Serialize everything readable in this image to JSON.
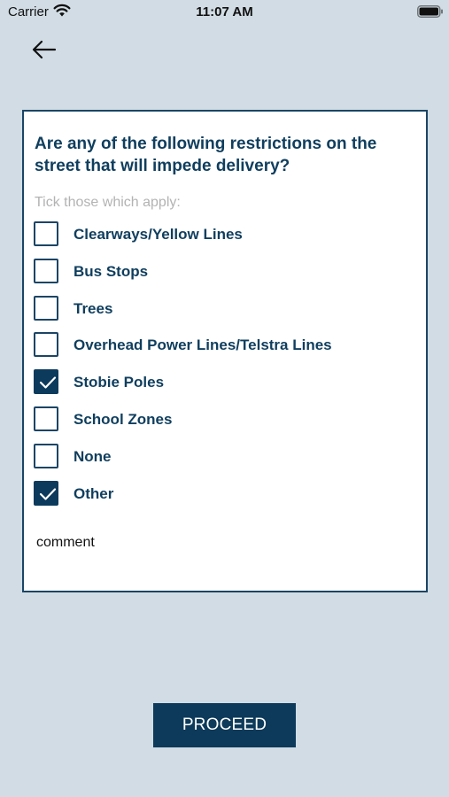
{
  "status_bar": {
    "carrier": "Carrier",
    "time": "11:07 AM"
  },
  "nav": {
    "back_icon": "arrow-left-icon"
  },
  "form": {
    "question": "Are any of the following restrictions on the street that will impede delivery?",
    "instruction": "Tick those which apply:",
    "options": [
      {
        "label": "Clearways/Yellow Lines",
        "checked": false
      },
      {
        "label": "Bus Stops",
        "checked": false
      },
      {
        "label": "Trees",
        "checked": false
      },
      {
        "label": "Overhead Power Lines/Telstra Lines",
        "checked": false
      },
      {
        "label": "Stobie Poles",
        "checked": true
      },
      {
        "label": "School Zones",
        "checked": false
      },
      {
        "label": "None",
        "checked": false
      },
      {
        "label": "Other",
        "checked": true
      }
    ],
    "comment_text": "comment"
  },
  "footer": {
    "proceed_label": "PROCEED"
  },
  "colors": {
    "background": "#d1dce4",
    "accent": "#0d3a5a",
    "text": "#0f3e5e"
  }
}
